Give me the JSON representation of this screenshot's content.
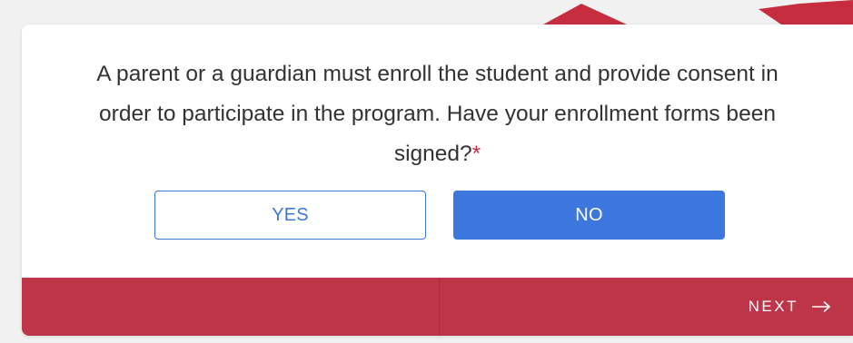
{
  "colors": {
    "accent_blue": "#3d76dc",
    "footer_red": "#be3549",
    "required_red": "#c62d3e",
    "text_dark": "#333333"
  },
  "question": {
    "text": "A parent or a guardian must enroll the student and provide consent in order to participate in the program. Have your enrollment forms been signed?",
    "required_mark": "*"
  },
  "options": {
    "yes_label": "YES",
    "no_label": "NO",
    "selected": "NO"
  },
  "footer": {
    "next_label": "NEXT",
    "next_icon": "arrow-right-icon"
  }
}
